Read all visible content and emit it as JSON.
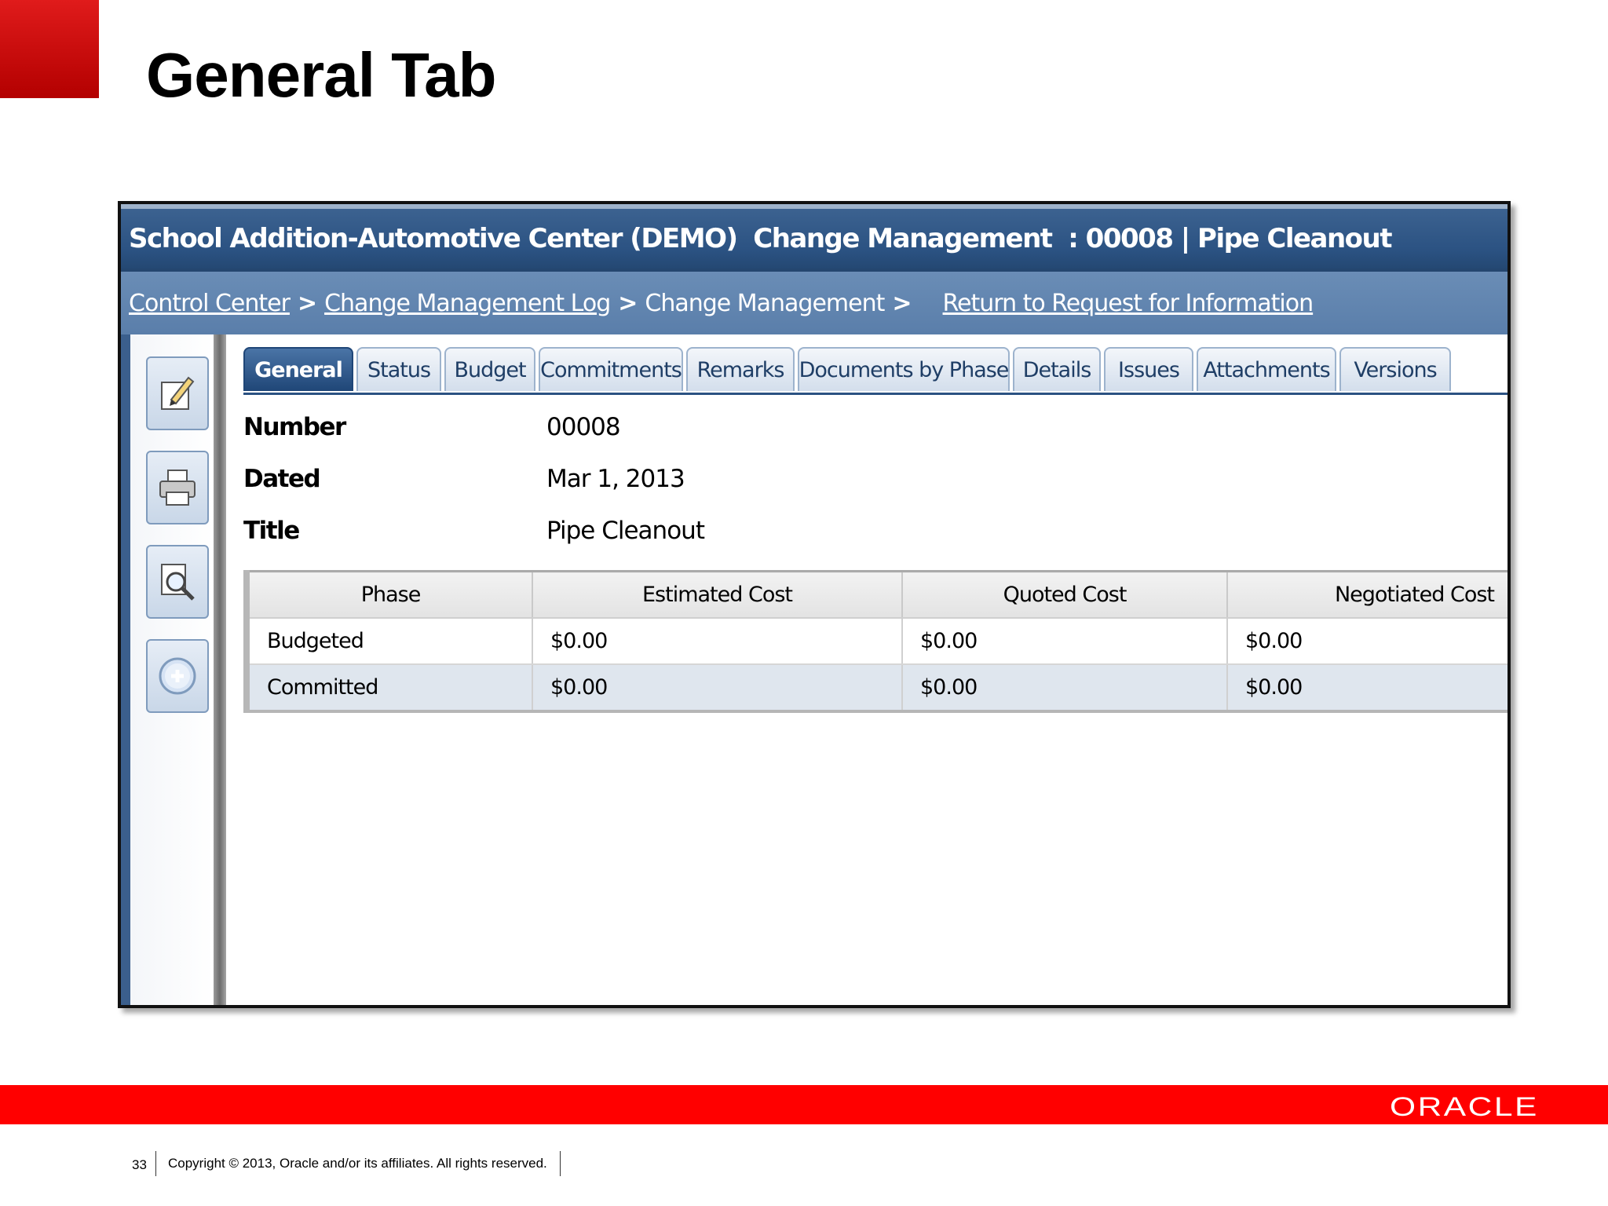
{
  "slide": {
    "title": "General Tab",
    "page_number": "33",
    "copyright": "Copyright © 2013, Oracle and/or its affiliates. All rights reserved.",
    "logo_text": "ORACLE",
    "brand_color": "#ff0000"
  },
  "app": {
    "header": {
      "project": "School Addition-Automotive Center (DEMO)",
      "module": "Change Management",
      "record": ": 00008 | Pipe Cleanout"
    },
    "breadcrumb": {
      "items": [
        "Control Center",
        "Change Management Log",
        "Change Management"
      ],
      "separator": ">",
      "return_link": "Return to Request for Information"
    },
    "toolbar": {
      "icons": [
        "edit-icon",
        "print-icon",
        "preview-icon",
        "add-icon"
      ]
    },
    "tabs": [
      "General",
      "Status",
      "Budget",
      "Commitments",
      "Remarks",
      "Documents by Phase",
      "Details",
      "Issues",
      "Attachments",
      "Versions"
    ],
    "active_tab": "General",
    "fields": {
      "number_label": "Number",
      "number_value": "00008",
      "dated_label": "Dated",
      "dated_value": "Mar 1, 2013",
      "title_label": "Title",
      "title_value": "Pipe Cleanout"
    },
    "cost_table": {
      "headers": [
        "Phase",
        "Estimated Cost",
        "Quoted Cost",
        "Negotiated Cost"
      ],
      "rows": [
        [
          "Budgeted",
          "$0.00",
          "$0.00",
          "$0.00"
        ],
        [
          "Committed",
          "$0.00",
          "$0.00",
          "$0.00"
        ]
      ]
    },
    "colors": {
      "header_blue": "#2b5282",
      "breadcrumb_blue": "#5a7eaa",
      "active_tab": "#1f4677"
    }
  }
}
